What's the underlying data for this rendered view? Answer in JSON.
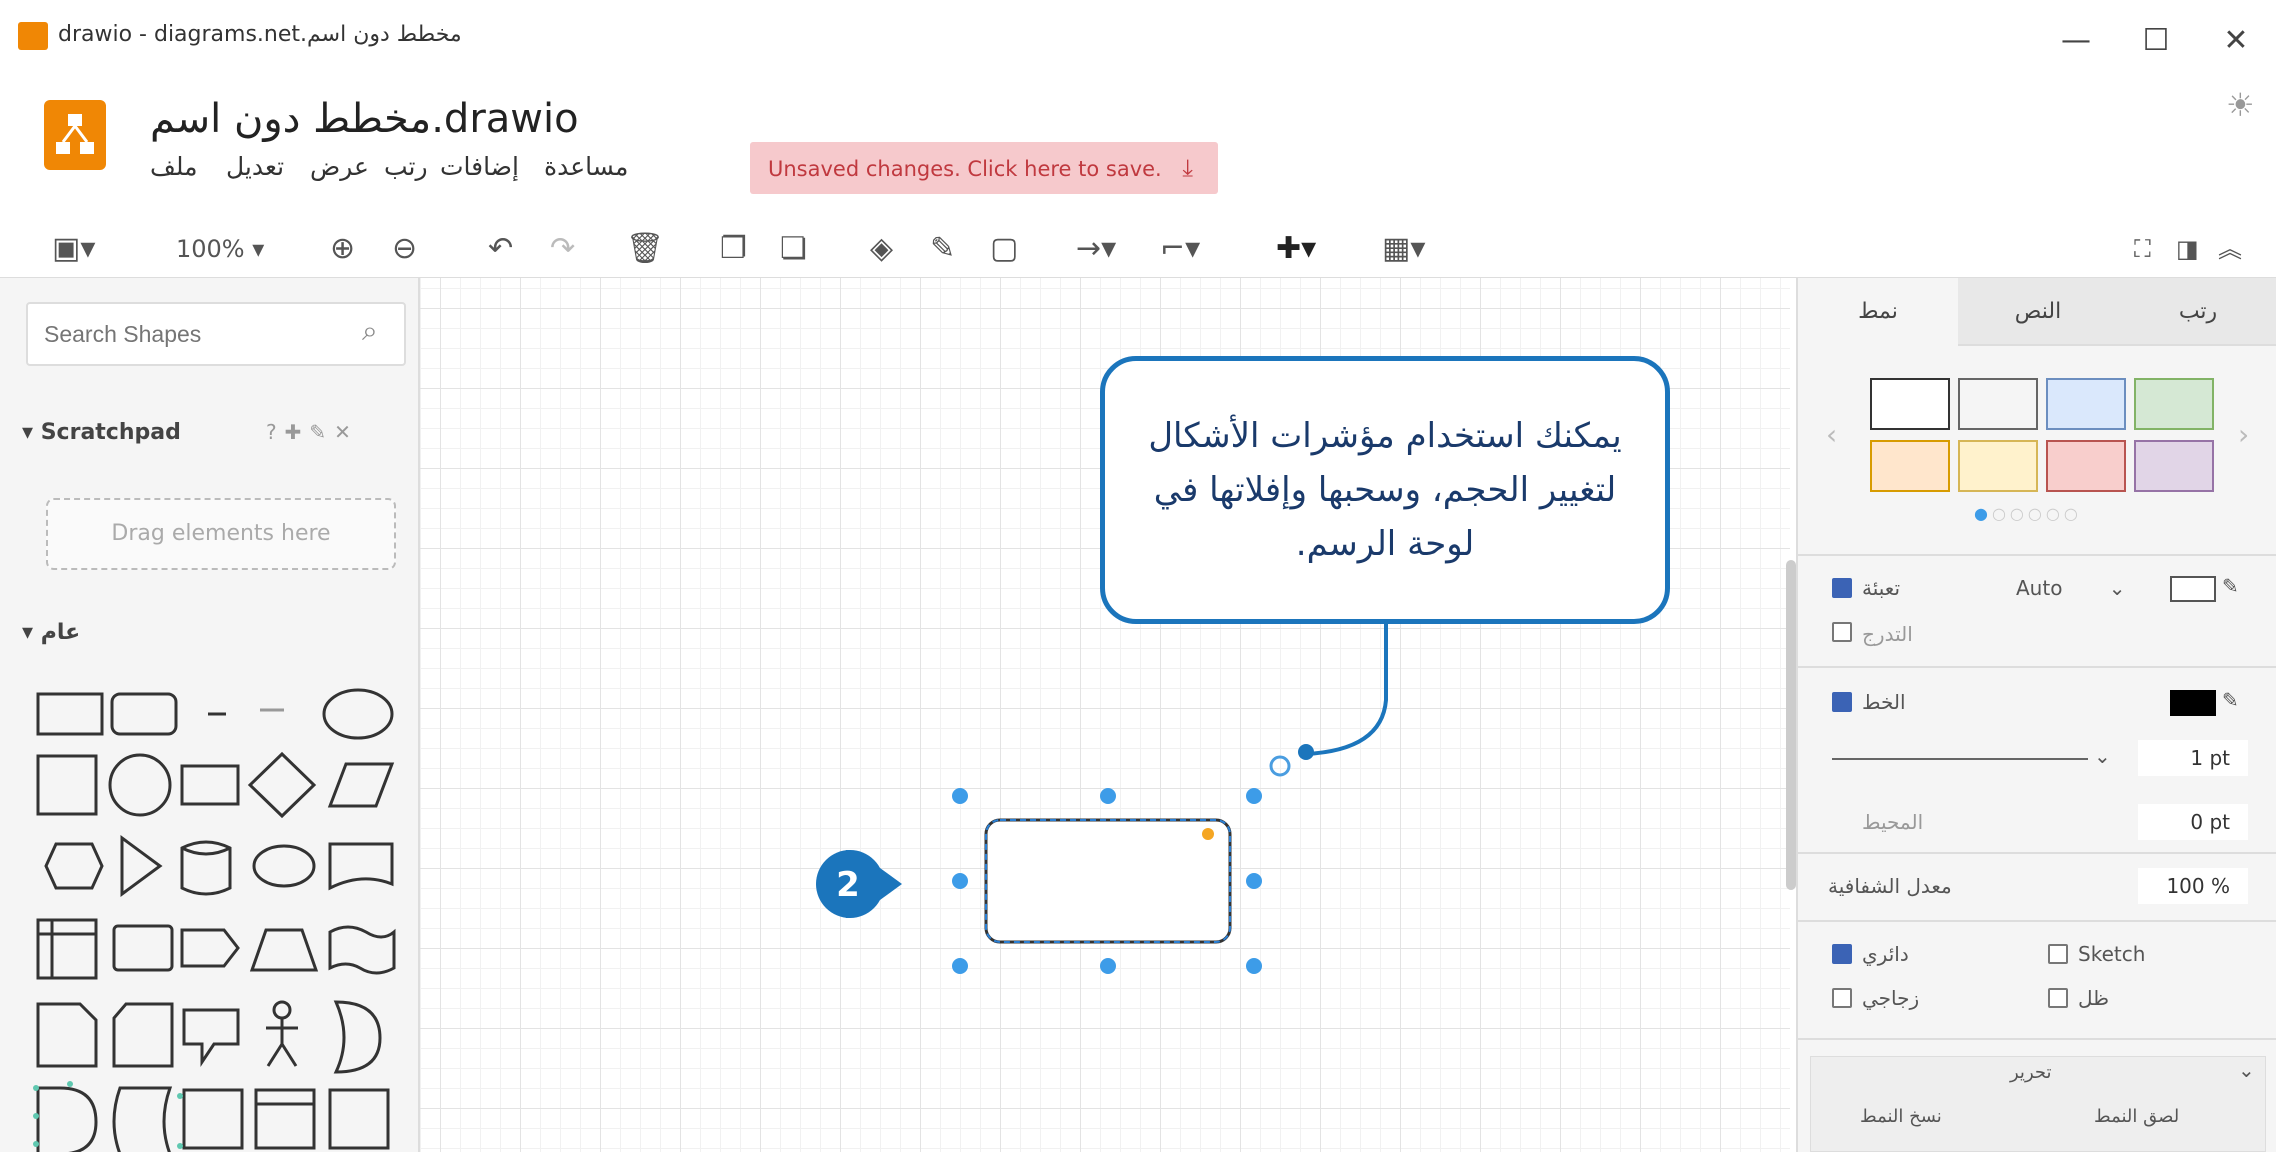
{
  "window": {
    "title": "مخطط دون اسم.drawio - diagrams.net",
    "minimize_glyph": "—",
    "maximize_glyph": "☐",
    "close_glyph": "✕"
  },
  "app": {
    "document_name": "مخطط دون اسم.drawio",
    "brand_color": "#f08705",
    "menus": [
      "ملف",
      "تعديل",
      "عرض",
      "رتب",
      "إضافات",
      "مساعدة"
    ],
    "unsaved_notice": "Unsaved changes. Click here to save.",
    "theme_icon": "sun-icon"
  },
  "toolbar": {
    "zoom": "100%",
    "icons": [
      "format-panel-icon",
      "zoom-in-icon",
      "zoom-out-icon",
      "undo-icon",
      "redo-icon",
      "delete-icon",
      "to-front-icon",
      "to-back-icon",
      "fill-color-icon",
      "line-color-icon",
      "shadow-icon",
      "connection-icon",
      "waypoints-icon",
      "insert-icon",
      "table-icon",
      "fullscreen-icon",
      "format-toggle-icon",
      "collapse-icon"
    ]
  },
  "left_panel": {
    "search_placeholder": "Search Shapes",
    "scratchpad_title": "Scratchpad",
    "scratchpad_drop": "Drag elements here",
    "general_section": "عام"
  },
  "callout": {
    "text": "يمكنك استخدام مؤشرات الأشكال لتغيير الحجم، وسحبها وإفلاتها في لوحة الرسم.",
    "color": "#1b75bc"
  },
  "step_badge": "2",
  "right_panel": {
    "tabs": [
      "رتب",
      "النص",
      "نمط"
    ],
    "style_swatches": [
      "#ffffff",
      "#f5f5f5",
      "#dae8fc",
      "#d5e8d4",
      "#ffe6cc",
      "#fff2cc",
      "#f8cecc",
      "#e1d5e7"
    ],
    "fill_label": "تعبئة",
    "fill_value": "Auto",
    "gradient_label": "التدرج",
    "line_label": "الخط",
    "line_width": "1 pt",
    "perimeter_label": "المحيط",
    "perimeter_value": "0 pt",
    "opacity_label": "معدل الشفافية",
    "opacity_value": "100 %",
    "rounded_label": "دائري",
    "sketch_label": "Sketch",
    "glass_label": "زجاجي",
    "shadow_label": "ظل",
    "property_label": "تحرير",
    "copy_style": "نسخ النمط",
    "paste_style": "لصق النمط"
  }
}
